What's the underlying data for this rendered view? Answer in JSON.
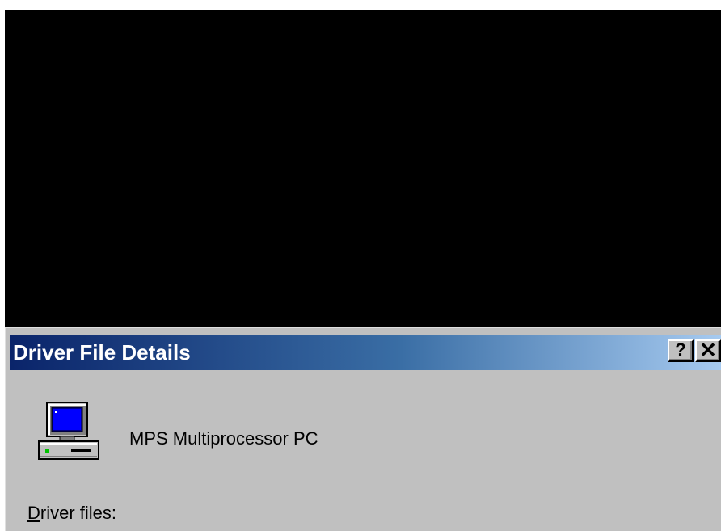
{
  "dialog": {
    "title": "Driver File Details",
    "help_button_label": "?",
    "close_button_label": "✕",
    "device_icon": "computer-icon",
    "device_name": "MPS Multiprocessor PC",
    "driver_files_label_accesskey": "D",
    "driver_files_label_rest": "river files:"
  },
  "colors": {
    "desktop_background": "#000000",
    "dialog_face": "#c0c0c0",
    "titlebar_start": "#0a246a",
    "titlebar_end": "#a6caf0",
    "title_text": "#ffffff"
  }
}
